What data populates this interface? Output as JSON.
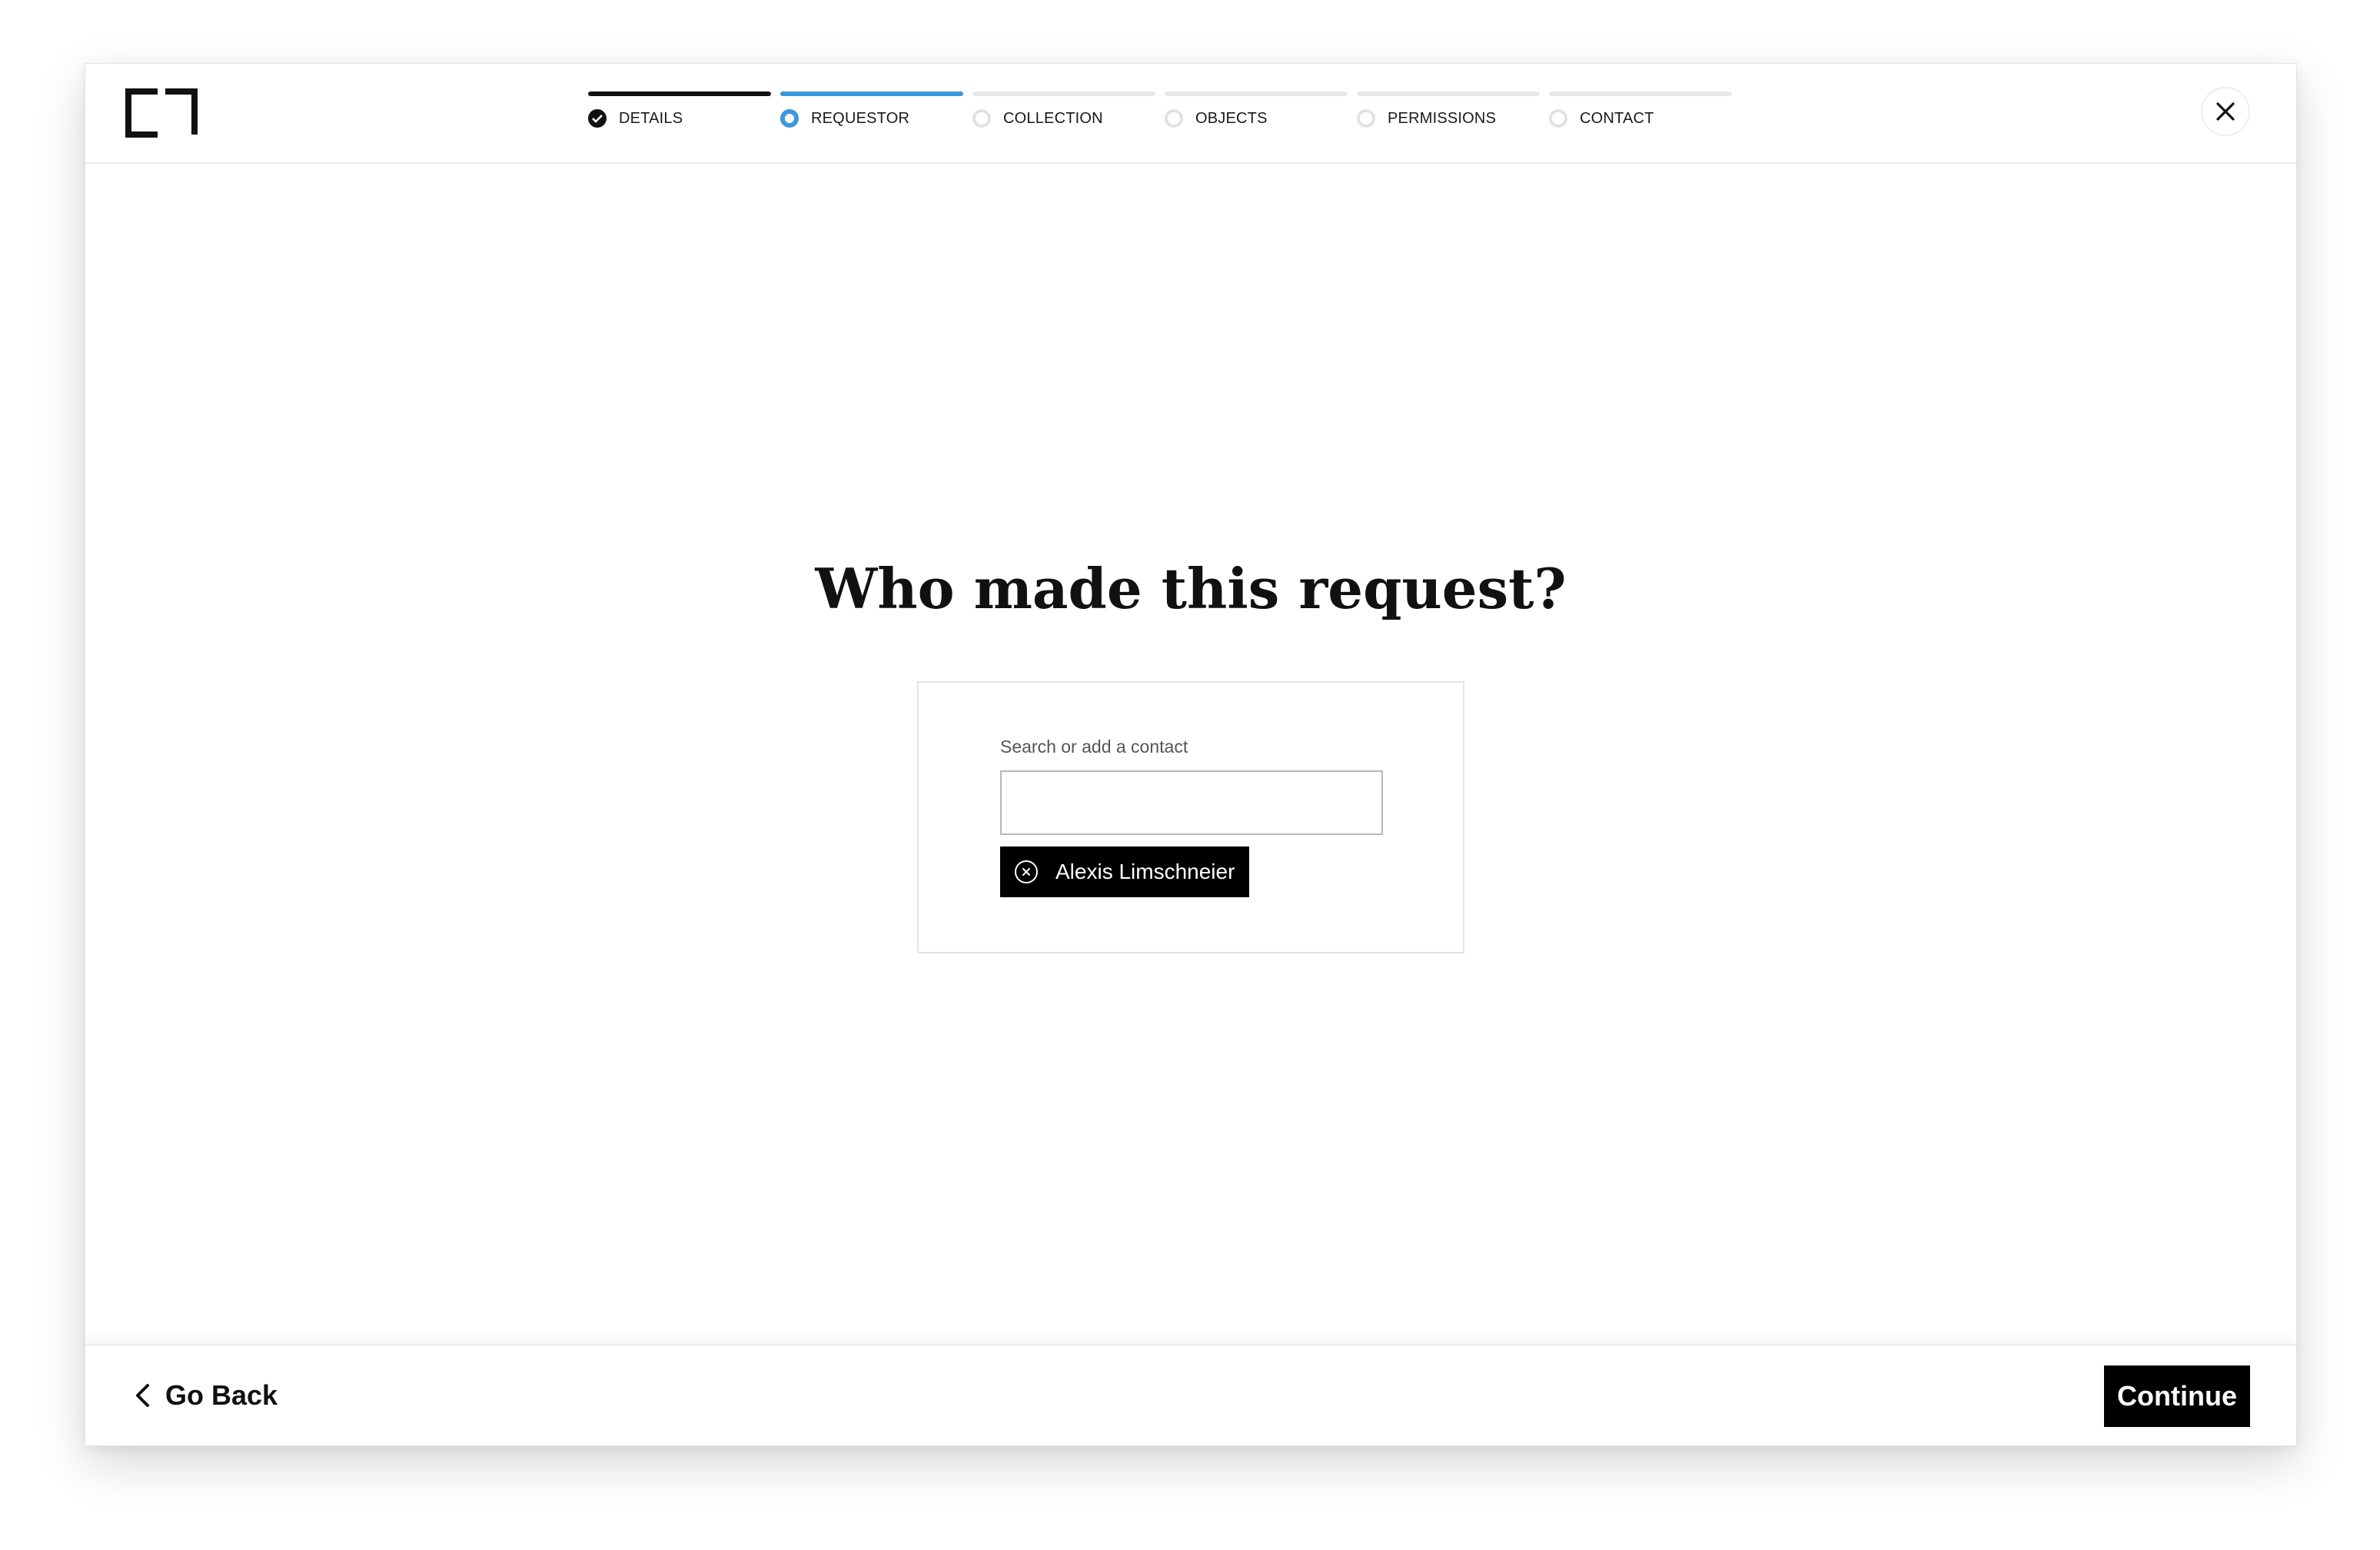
{
  "header": {
    "logo_icon": "bracket-logo-icon",
    "close_icon": "close-icon",
    "steps": [
      {
        "label": "DETAILS",
        "state": "done"
      },
      {
        "label": "REQUESTOR",
        "state": "active"
      },
      {
        "label": "COLLECTION",
        "state": "pending"
      },
      {
        "label": "OBJECTS",
        "state": "pending"
      },
      {
        "label": "PERMISSIONS",
        "state": "pending"
      },
      {
        "label": "CONTACT",
        "state": "pending"
      }
    ]
  },
  "main": {
    "heading": "Who made this request?",
    "search": {
      "label": "Search or add a contact",
      "value": "",
      "placeholder": ""
    },
    "selected_contact": {
      "name": "Alexis Limschneier",
      "remove_icon": "remove-circle-icon"
    }
  },
  "footer": {
    "back_label": "Go Back",
    "back_icon": "chevron-left-icon",
    "continue_label": "Continue"
  },
  "colors": {
    "accent": "#3d97dc",
    "primary": "#000000",
    "track": "#e8e8e8"
  }
}
